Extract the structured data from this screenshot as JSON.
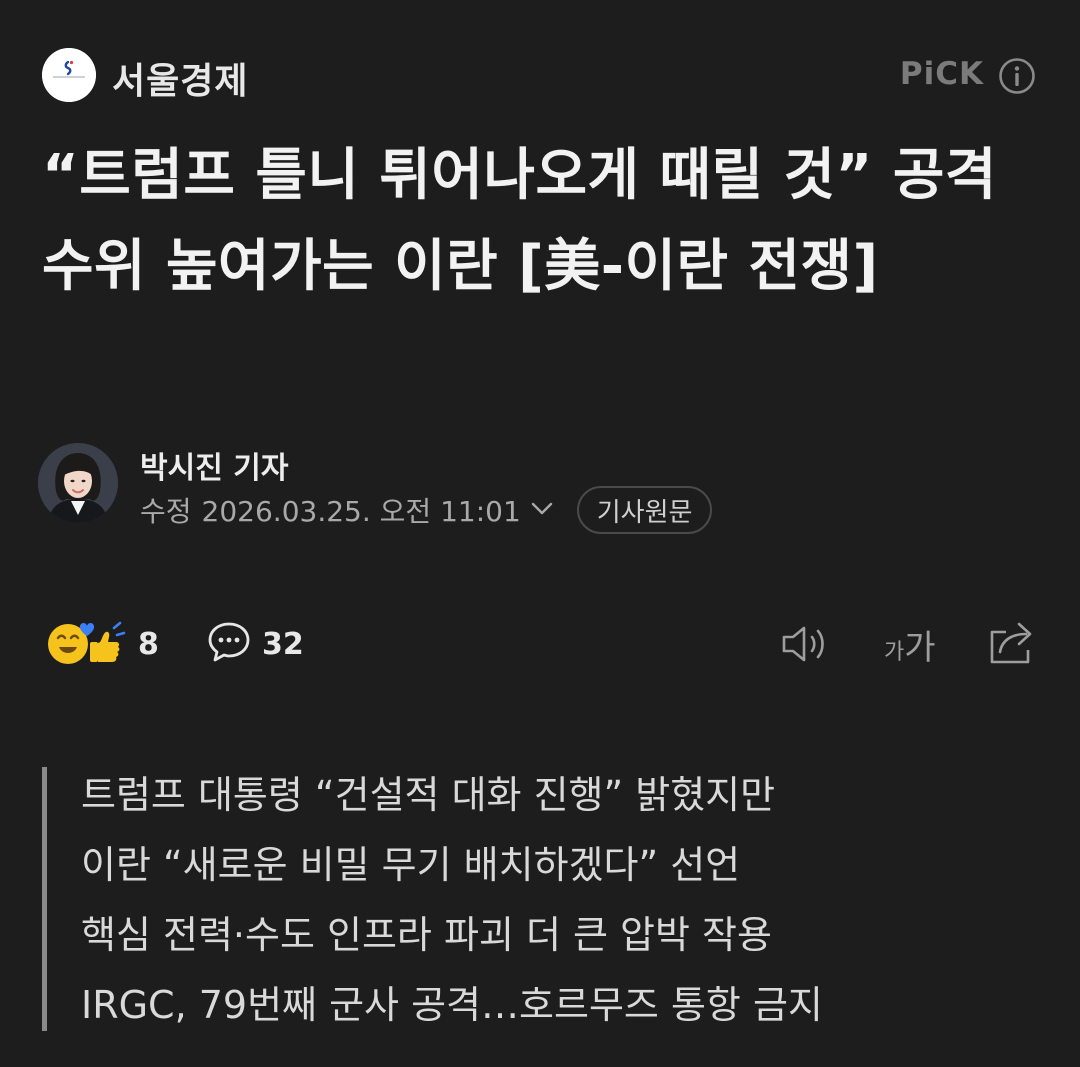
{
  "press": {
    "name": "서울경제",
    "logo_text": "서울경제"
  },
  "pick": {
    "label": "PiCK"
  },
  "article": {
    "headline": "“트럼프 틀니 튀어나오게 때릴 것” 공격 수위 높여가는 이란 [美-이란 전쟁]",
    "author": "박시진 기자",
    "date_label": "수정",
    "date_value": "2026.03.25. 오전 11:01",
    "original_button": "기사원문"
  },
  "actions": {
    "reaction_count": "8",
    "comment_count": "32",
    "font_small": "가",
    "font_large": "가"
  },
  "summary": [
    "트럼프 대통령 “건설적 대화 진행” 밝혔지만",
    "이란 “새로운 비밀 무기 배치하겠다” 선언",
    "핵심 전력·수도 인프라 파괴 더 큰 압박 작용",
    "IRGC, 79번째 군사 공격…호르무즈 통항 금지"
  ],
  "colors": {
    "background": "#1e1d1e",
    "text_primary": "#f2f2f2",
    "text_secondary": "#a9a9a9",
    "pick_gray": "#7b7b7b",
    "summary_bar": "#8a8a8a",
    "emoji_yellow": "#f6c21c",
    "emoji_blue": "#3d7ff5"
  },
  "icons": [
    "info-icon",
    "chevron-down-icon",
    "reaction-emoji-icon",
    "comment-icon",
    "speaker-icon",
    "font-size-icon",
    "share-icon"
  ]
}
